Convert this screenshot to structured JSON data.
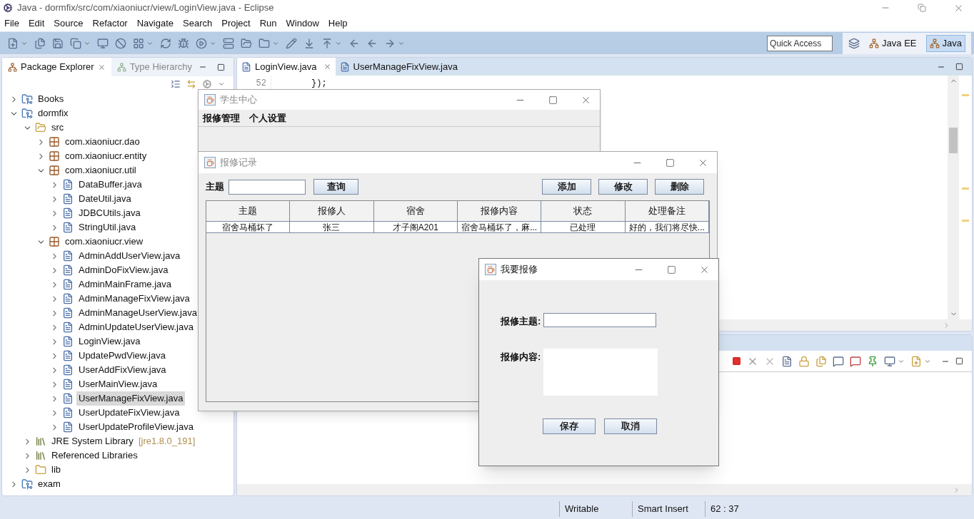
{
  "window": {
    "title": "Java - dormfix/src/com/xiaoniucr/view/LoginView.java - Eclipse"
  },
  "menu": [
    "File",
    "Edit",
    "Source",
    "Refactor",
    "Navigate",
    "Search",
    "Project",
    "Run",
    "Window",
    "Help"
  ],
  "toolbar": {
    "quick_access": {
      "placeholder": "Quick Access"
    },
    "perspectives": [
      {
        "label": "Java EE",
        "selected": false
      },
      {
        "label": "Java",
        "selected": true
      }
    ]
  },
  "package_explorer": {
    "tabs": [
      {
        "label": "Package Explorer",
        "selected": true
      },
      {
        "label": "Type Hierarchy",
        "selected": false
      }
    ],
    "tree": [
      {
        "label": "Books",
        "kind": "project",
        "expanded": false,
        "selected": false
      },
      {
        "label": "dormfix",
        "kind": "project",
        "expanded": true,
        "selected": false,
        "children": [
          {
            "label": "src",
            "kind": "source",
            "expanded": true,
            "selected": false,
            "children": [
              {
                "label": "com.xiaoniucr.dao",
                "kind": "package",
                "expanded": false,
                "selected": false
              },
              {
                "label": "com.xiaoniucr.entity",
                "kind": "package",
                "expanded": false,
                "selected": false
              },
              {
                "label": "com.xiaoniucr.util",
                "kind": "package",
                "expanded": true,
                "selected": false,
                "children": [
                  {
                    "label": "DataBuffer.java",
                    "kind": "java",
                    "expanded": false,
                    "selected": false
                  },
                  {
                    "label": "DateUtil.java",
                    "kind": "java",
                    "expanded": false,
                    "selected": false
                  },
                  {
                    "label": "JDBCUtils.java",
                    "kind": "java",
                    "expanded": false,
                    "selected": false
                  },
                  {
                    "label": "StringUtil.java",
                    "kind": "java",
                    "expanded": false,
                    "selected": false
                  }
                ]
              },
              {
                "label": "com.xiaoniucr.view",
                "kind": "package",
                "expanded": true,
                "selected": false,
                "children": [
                  {
                    "label": "AdminAddUserView.java",
                    "kind": "java",
                    "expanded": false,
                    "selected": false
                  },
                  {
                    "label": "AdminDoFixView.java",
                    "kind": "java",
                    "expanded": false,
                    "selected": false
                  },
                  {
                    "label": "AdminMainFrame.java",
                    "kind": "java",
                    "expanded": false,
                    "selected": false
                  },
                  {
                    "label": "AdminManageFixView.java",
                    "kind": "java",
                    "expanded": false,
                    "selected": false
                  },
                  {
                    "label": "AdminManageUserView.java",
                    "kind": "java",
                    "expanded": false,
                    "selected": false
                  },
                  {
                    "label": "AdminUpdateUserView.java",
                    "kind": "java",
                    "expanded": false,
                    "selected": false
                  },
                  {
                    "label": "LoginView.java",
                    "kind": "java",
                    "expanded": false,
                    "selected": false
                  },
                  {
                    "label": "UpdatePwdView.java",
                    "kind": "java",
                    "expanded": false,
                    "selected": false
                  },
                  {
                    "label": "UserAddFixView.java",
                    "kind": "java",
                    "expanded": false,
                    "selected": false
                  },
                  {
                    "label": "UserMainView.java",
                    "kind": "java",
                    "expanded": false,
                    "selected": false
                  },
                  {
                    "label": "UserManageFixView.java",
                    "kind": "java",
                    "expanded": false,
                    "selected": true
                  },
                  {
                    "label": "UserUpdateFixView.java",
                    "kind": "java",
                    "expanded": false,
                    "selected": false
                  },
                  {
                    "label": "UserUpdateProfileView.java",
                    "kind": "java",
                    "expanded": false,
                    "selected": false
                  }
                ]
              }
            ]
          },
          {
            "label": "JRE System Library",
            "qualifier": "[jre1.8.0_191]",
            "kind": "library",
            "expanded": false,
            "selected": false
          },
          {
            "label": "Referenced Libraries",
            "kind": "library",
            "expanded": false,
            "selected": false
          },
          {
            "label": "lib",
            "kind": "folder",
            "expanded": false,
            "selected": false
          }
        ]
      },
      {
        "label": "exam",
        "kind": "project",
        "expanded": false,
        "selected": false
      }
    ]
  },
  "editor": {
    "tabs": [
      {
        "label": "LoginView.java",
        "selected": true
      },
      {
        "label": "UserManageFixView.java",
        "selected": false
      }
    ],
    "lines": [
      {
        "number": "52",
        "code": "});"
      }
    ]
  },
  "status_bar": [
    "Writable",
    "Smart Insert",
    "62 : 37"
  ],
  "student_center_window": {
    "title": "学生中心",
    "menu": [
      "报修管理",
      "个人设置"
    ]
  },
  "repair_records_window": {
    "title": "报修记录",
    "search_label": "主题",
    "buttons": [
      "查询",
      "添加",
      "修改",
      "删除"
    ],
    "table": {
      "columns": [
        "主题",
        "报修人",
        "宿舍",
        "报修内容",
        "状态",
        "处理备注"
      ],
      "rows": [
        [
          "宿舍马桶坏了",
          "张三",
          "才子阁A201",
          "宿舍马桶坏了，麻...",
          "已处理",
          "好的，我们将尽快..."
        ]
      ]
    }
  },
  "repair_request_dialog": {
    "title": "我要报修",
    "fields": [
      {
        "label": "报修主题:",
        "kind": "line"
      },
      {
        "label": "报修内容:",
        "kind": "area"
      }
    ],
    "buttons": [
      "保存",
      "取消"
    ]
  }
}
